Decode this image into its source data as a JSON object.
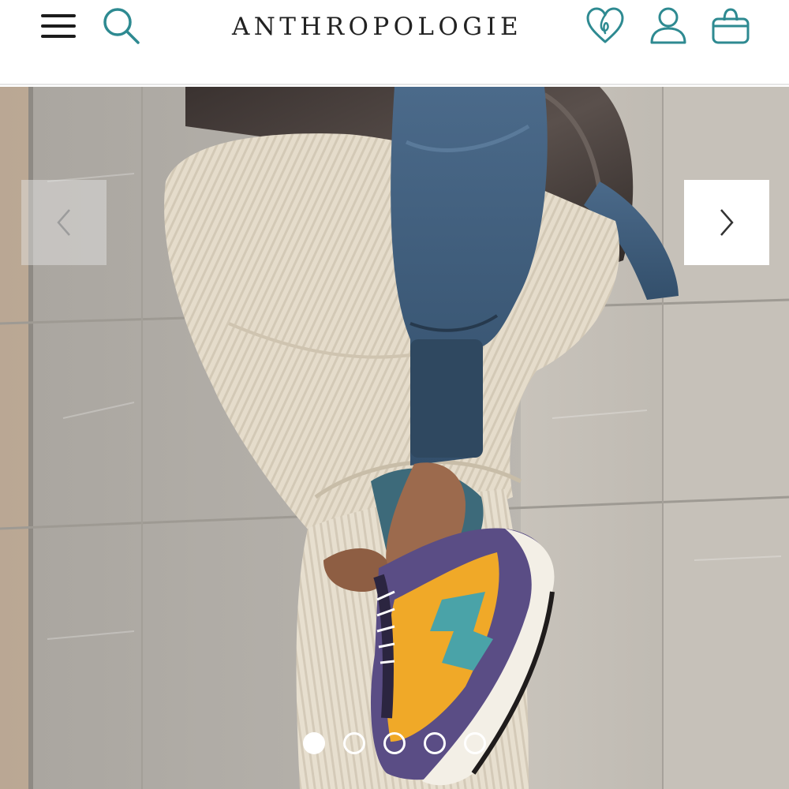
{
  "header": {
    "brand": "ANTHROPOLOGIE",
    "icons": {
      "menu": "hamburger-menu-icon",
      "search": "search-icon",
      "wishlist": "heart-icon",
      "account": "user-icon",
      "cart": "shopping-bag-icon"
    }
  },
  "carousel": {
    "slide_count": 5,
    "active_index": 0,
    "prev_icon": "chevron-left-icon",
    "next_icon": "chevron-right-icon"
  },
  "colors": {
    "accent": "#2e8a91",
    "text": "#222222"
  }
}
